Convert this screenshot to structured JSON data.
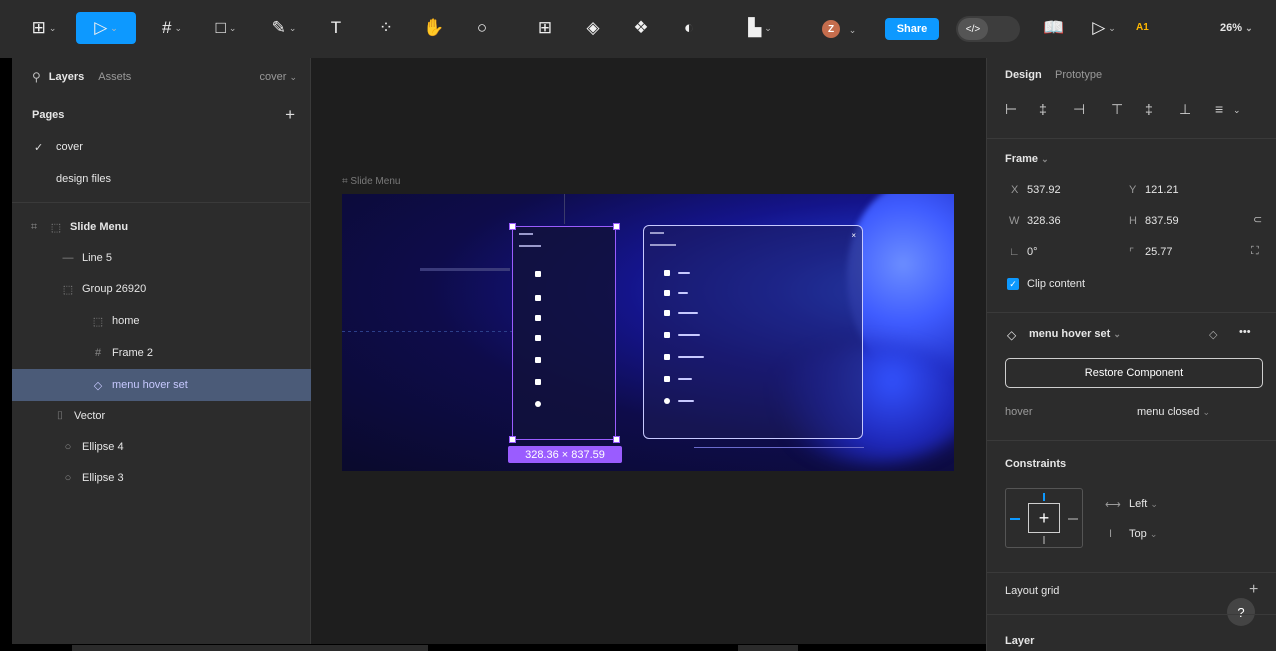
{
  "toolbar": {
    "tools": [
      {
        "name": "main-menu",
        "glyph": "⊞"
      },
      {
        "name": "move-tool",
        "glyph": "▷"
      },
      {
        "name": "frame-tool",
        "glyph": "#"
      },
      {
        "name": "shape-tool",
        "glyph": "□"
      },
      {
        "name": "pen-tool",
        "glyph": "✎"
      },
      {
        "name": "text-tool",
        "glyph": "T"
      },
      {
        "name": "resources-tool",
        "glyph": "⁘"
      },
      {
        "name": "hand-tool",
        "glyph": "✋"
      },
      {
        "name": "comment-tool",
        "glyph": "○"
      }
    ],
    "avatar_initial": "Z",
    "share_label": "Share",
    "code_label": "</>",
    "mode_label": "A1",
    "zoom": "26%"
  },
  "left_panel": {
    "tab_layers": "Layers",
    "tab_assets": "Assets",
    "page_selector": "cover",
    "pages_heading": "Pages",
    "add_symbol": "+",
    "pages": [
      {
        "label": "cover",
        "active": true
      },
      {
        "label": "design files",
        "active": false
      }
    ],
    "layers": [
      {
        "label": "Slide Menu",
        "icon": "⌗",
        "bold": true
      },
      {
        "label": "Line 5",
        "icon": "—"
      },
      {
        "label": "Group 26920",
        "icon": "⬚"
      },
      {
        "label": "home",
        "icon": "⬚"
      },
      {
        "label": "Frame 2",
        "icon": "#"
      },
      {
        "label": "menu hover set",
        "icon": "◇",
        "selected": true
      },
      {
        "label": "Vector",
        "icon": "⌷"
      },
      {
        "label": "Ellipse 4",
        "icon": "○"
      },
      {
        "label": "Ellipse 3",
        "icon": "○"
      }
    ]
  },
  "canvas": {
    "frame_label": "Slide Menu",
    "dimension_badge": "328.36 × 837.59"
  },
  "right_panel": {
    "tab_design": "Design",
    "tab_prototype": "Prototype",
    "frame_heading": "Frame",
    "x_label": "X",
    "x_value": "537.92",
    "y_label": "Y",
    "y_value": "121.21",
    "w_label": "W",
    "w_value": "328.36",
    "h_label": "H",
    "h_value": "837.59",
    "rotation_value": "0°",
    "radius_value": "25.77",
    "clip_content": "Clip content",
    "component_name": "menu hover set",
    "restore_label": "Restore Component",
    "variant_prop": "hover",
    "variant_value": "menu closed",
    "constraints_heading": "Constraints",
    "constraint_h": "Left",
    "constraint_v": "Top",
    "layout_grid": "Layout grid",
    "layer_heading": "Layer",
    "help": "?"
  },
  "colors": {
    "accent": "#0d99ff",
    "selection": "#9a5cff",
    "panel": "#2c2c2c",
    "canvas": "#1e1e1e"
  }
}
